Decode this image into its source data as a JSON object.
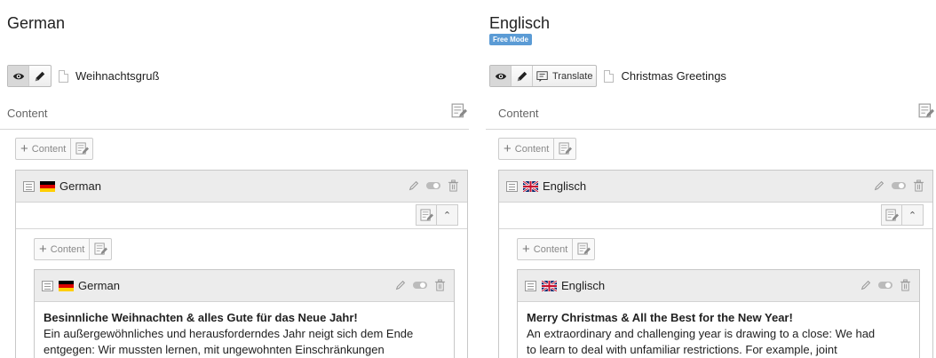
{
  "left": {
    "language_title": "German",
    "toolbar": {
      "view_icon": "eye-icon",
      "edit_icon": "pencil-icon"
    },
    "page_title": "Weihnachtsgruß",
    "content_label": "Content",
    "add_content_label": "Content",
    "container": {
      "title": "German",
      "flag": "de"
    },
    "inner_add_content_label": "Content",
    "element": {
      "title": "German",
      "flag": "de",
      "heading": "Besinnliche Weihnachten & alles Gute für das Neue Jahr!",
      "line1": "Ein außergewöhnliches und herausforderndes Jahr neigt sich dem Ende",
      "line2": "entgegen: Wir mussten lernen, mit ungewohnten Einschränkungen"
    }
  },
  "right": {
    "language_title": "Englisch",
    "mode_badge": "Free Mode",
    "toolbar": {
      "view_icon": "eye-icon",
      "edit_icon": "pencil-icon",
      "translate_label": "Translate"
    },
    "page_title": "Christmas Greetings",
    "content_label": "Content",
    "add_content_label": "Content",
    "container": {
      "title": "Englisch",
      "flag": "gb"
    },
    "inner_add_content_label": "Content",
    "element": {
      "title": "Englisch",
      "flag": "gb",
      "heading": "Merry Christmas & All the Best for the New Year!",
      "line1": "An extraordinary and challenging year is drawing to a close: We had",
      "line2": "to learn to deal with unfamiliar restrictions. For example, joint"
    }
  }
}
